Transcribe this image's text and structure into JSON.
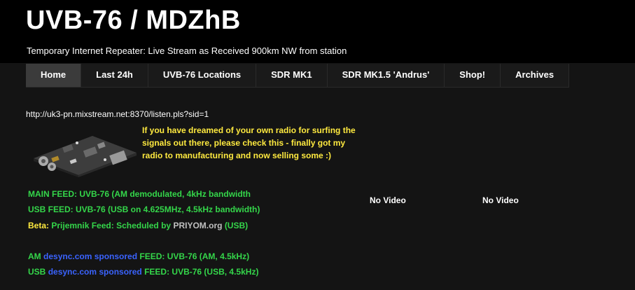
{
  "header": {
    "title": "UVB-76 / MDZhB",
    "tagline": "Temporary Internet Repeater: Live Stream as Received 900km NW from station"
  },
  "nav": {
    "items": [
      {
        "label": "Home"
      },
      {
        "label": "Last 24h"
      },
      {
        "label": "UVB-76 Locations"
      },
      {
        "label": "SDR MK1"
      },
      {
        "label": "SDR MK1.5 'Andrus'"
      },
      {
        "label": "Shop!"
      },
      {
        "label": "Archives"
      }
    ]
  },
  "main": {
    "stream_url": "http://uk3-pn.mixstream.net:8370/listen.pls?sid=1",
    "promo_text": "If you have dreamed of your own radio for surfing the signals out there, please check this - finally got my radio to manufacturing and now selling some :)",
    "feeds": {
      "main_feed": "MAIN FEED: UVB-76 (AM demodulated, 4kHz bandwidth",
      "usb_feed": "USB FEED: UVB-76 (USB on 4.625MHz, 4.5kHz bandwidth)",
      "beta_label": "Beta:",
      "beta_link": "Prijemnik Feed",
      "beta_colon": ":",
      "beta_sched": "Scheduled by",
      "beta_priyom": "PRIYOM.org",
      "beta_usb": "(USB)",
      "am_prefix": "AM",
      "am_sponsor": "desync.com sponsored",
      "am_suffix": "FEED: UVB-76 (AM, 4.5kHz)",
      "usb_prefix": "USB",
      "usb_sponsor": "desync.com sponsored",
      "usb_suffix": "FEED: UVB-76 (USB, 4.5kHz)"
    },
    "video_left": "No Video",
    "video_right": "No Video"
  },
  "colors": {
    "background": "#141414",
    "header_bg": "#000000",
    "green": "#34d64a",
    "yellow": "#ffea3f",
    "blue": "#3a63ff",
    "nav_active": "#3b3b3b"
  }
}
